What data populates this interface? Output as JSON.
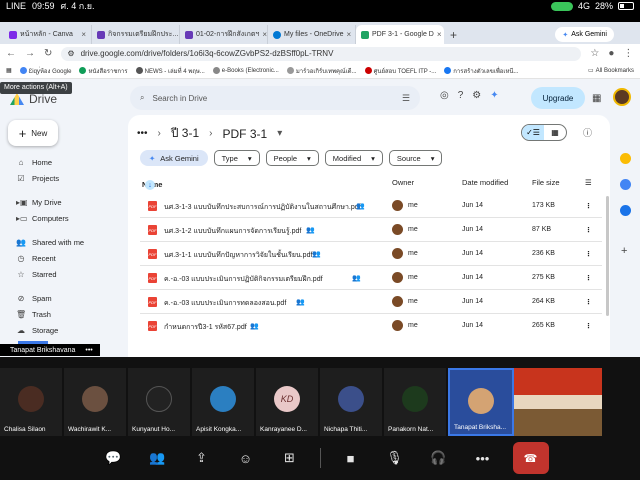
{
  "status": {
    "time": "09:59",
    "app": "LINE",
    "date": "ศ. 4 ก.ย.",
    "signal": "4G",
    "battery": "28%"
  },
  "tabs": [
    {
      "label": "หน้าหลัก - Canva",
      "color": "#7d2ae8"
    },
    {
      "label": "กิจกรรมเตรียมฝึกประ...",
      "color": "#673ab7"
    },
    {
      "label": "01-02-การฝึกสังเกตฯ",
      "color": "#673ab7"
    },
    {
      "label": "My files - OneDrive",
      "color": "#0078d4"
    },
    {
      "label": "PDF 3-1 - Google D",
      "color": "#1fa463",
      "active": true
    }
  ],
  "ask_gemini_tab": "Ask Gemini",
  "url": "drive.google.com/drive/folders/1o6i3q-6cowZGvbPS2-dzBSff0pL-TRNV",
  "bookmarks": [
    "Ɛiqy่ห้อง Google",
    "หนังสือราชการ",
    "NEWS - เล่มที่ 4 พฤษ...",
    "e-Books (Electronic...",
    "มาร์วอเกิร์บเทพคุณ์เดี...",
    "ศูนย์สอบ TOEFL ITP -...",
    "การสร้างตัวเลขเพื่อเหนี...",
    "All Bookmarks"
  ],
  "tooltip": "More actions (Alt+A)",
  "brand": "Drive",
  "search_placeholder": "Search in Drive",
  "upgrade_label": "Upgrade",
  "new_label": "New",
  "sidebar": {
    "group1": [
      "Home",
      "Projects"
    ],
    "group2": [
      "My Drive",
      "Computers"
    ],
    "group3": [
      "Shared with me",
      "Recent",
      "Starred"
    ],
    "group4": [
      "Spam",
      "Trash",
      "Storage"
    ]
  },
  "breadcrumb": {
    "parent": "ปี 3-1",
    "current": "PDF 3-1"
  },
  "filters": {
    "gemini": "Ask Gemini",
    "type": "Type",
    "people": "People",
    "modified": "Modified",
    "source": "Source"
  },
  "columns": {
    "name": "Name",
    "owner": "Owner",
    "modified": "Date modified",
    "size": "File size"
  },
  "files": [
    {
      "name": "นศ.3-1-3 แบบบันทึกประสบการณ์การปฏิบัติงานในสถานศึกษา.pdf",
      "owner": "me",
      "modified": "Jun 14",
      "size": "173 KB"
    },
    {
      "name": "นศ.3-1-2 แบบบันทึกแผนการจัดการเรียนรู้.pdf",
      "owner": "me",
      "modified": "Jun 14",
      "size": "87 KB"
    },
    {
      "name": "นศ.3-1-1 แบบบันทึกปัญหาการวิจัยในชั้นเรียน.pdf",
      "owner": "me",
      "modified": "Jun 14",
      "size": "236 KB"
    },
    {
      "name": "ค.-อ.-03 แบบประเมินการปฏิบัติกิจกรรมเตรียมฝึก.pdf",
      "owner": "me",
      "modified": "Jun 14",
      "size": "275 KB"
    },
    {
      "name": "ค.-อ.-03 แบบประเมินการทดลองสอน.pdf",
      "owner": "me",
      "modified": "Jun 14",
      "size": "264 KB"
    },
    {
      "name": "กำหนดการปี3-1 รหัส67.pdf",
      "owner": "me",
      "modified": "Jun 14",
      "size": "265 KB"
    }
  ],
  "presenter_label": "Tanapat Brikshavana",
  "participants": [
    {
      "name": "Chalisa Silaon",
      "color": "#4a2c22"
    },
    {
      "name": "Wachirawit K...",
      "color": "#6b5040"
    },
    {
      "name": "Kunyanut Ho...",
      "color": "#222"
    },
    {
      "name": "Apisit Kongka...",
      "color": "#2b7fc1"
    },
    {
      "name": "Kanrayanee D...",
      "initials": "KD"
    },
    {
      "name": "Nichapa Thiti...",
      "color": "#3b4f8a"
    },
    {
      "name": "Panakorn Nat...",
      "color": "#1d3a1d"
    },
    {
      "name": "Tanapat Briksha...",
      "color": "#d4a373",
      "highlight": true
    }
  ]
}
